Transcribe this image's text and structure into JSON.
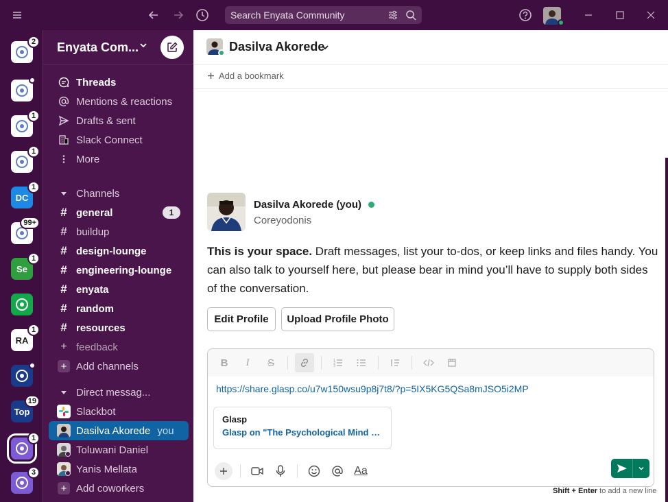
{
  "titlebar": {
    "search_placeholder": "Search Enyata Community"
  },
  "workspaces": [
    {
      "badge": "2",
      "color": "#ffffff",
      "label": ""
    },
    {
      "badge": "",
      "dot": true,
      "color": "#ffffff",
      "label": ""
    },
    {
      "badge": "1",
      "color": "#ffffff",
      "label": ""
    },
    {
      "badge": "1",
      "color": "#ffffff",
      "label": ""
    },
    {
      "badge": "1",
      "color": "#1e88e5",
      "label": "DC"
    },
    {
      "badge": "99+",
      "color": "#ffffff",
      "label": ""
    },
    {
      "badge": "1",
      "color": "#2e9e3f",
      "label": "Se"
    },
    {
      "badge": "",
      "color": "#15a84a",
      "label": ""
    },
    {
      "badge": "1",
      "color": "#ffffff",
      "label": "RA"
    },
    {
      "badge": "",
      "dot": true,
      "color": "#1a3a8a",
      "label": ""
    },
    {
      "badge": "19",
      "color": "#1a3a8a",
      "label": "Top"
    },
    {
      "badge": "1",
      "color": "#7b5cd6",
      "label": "",
      "active": true
    },
    {
      "badge": "3",
      "color": "#7b5cd6",
      "label": ""
    }
  ],
  "sidebar": {
    "workspace_name": "Enyata Com...",
    "nav": {
      "threads": "Threads",
      "mentions": "Mentions & reactions",
      "drafts": "Drafts & sent",
      "connect": "Slack Connect",
      "more": "More"
    },
    "channels_header": "Channels",
    "channels": [
      {
        "name": "general",
        "bold": true,
        "count": "1"
      },
      {
        "name": "buildup",
        "bold": false
      },
      {
        "name": "design-lounge",
        "bold": true
      },
      {
        "name": "engineering-lounge",
        "bold": true
      },
      {
        "name": "enyata",
        "bold": true
      },
      {
        "name": "random",
        "bold": true
      },
      {
        "name": "resources",
        "bold": true
      },
      {
        "name": "feedback",
        "bold": false,
        "muted": true
      }
    ],
    "add_channels": "Add channels",
    "dm_header": "Direct messag...",
    "dms": {
      "slackbot": "Slackbot",
      "self": "Dasilva Akorede",
      "self_tag": "you",
      "toluwani": "Toluwani Daniel",
      "yanis": "Yanis Mellata"
    },
    "add_coworkers": "Add coworkers"
  },
  "channel": {
    "title": "Dasilva Akorede",
    "bookmark": "Add a bookmark"
  },
  "intro": {
    "name": "Dasilva Akorede (you)",
    "handle": "Coreyodonis",
    "lead": "This is your space.",
    "body": " Draft messages, list your to-dos, or keep links and files handy. You can also talk to yourself here, but please bear in mind you’ll have to supply both sides of the conversation.",
    "edit_profile": "Edit Profile",
    "upload_photo": "Upload Profile Photo"
  },
  "composer": {
    "message_text": "https://share.glasp.co/u7w150wsu9p8j7t8/?p=5IX5KG5QSa8mJSO5i2MP",
    "preview_title": "Glasp",
    "preview_desc": "Glasp on \"The Psychological Mind Tric...",
    "format_label": "Aa"
  },
  "hint": {
    "keys": "Shift + Enter",
    "text": " to add a new line"
  }
}
